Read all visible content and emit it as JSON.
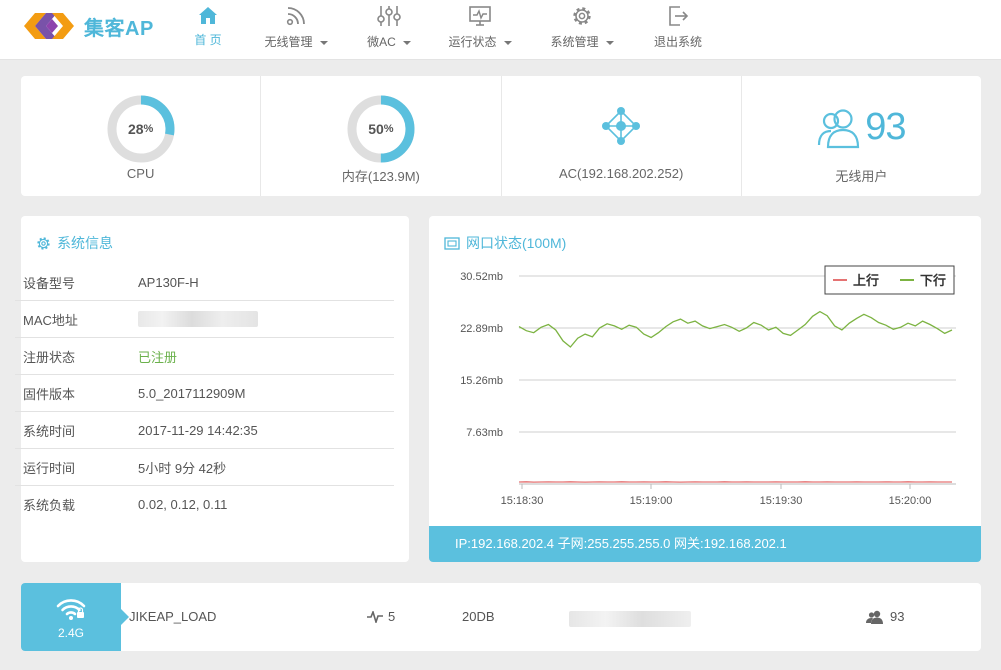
{
  "brand": {
    "name": "集客AP"
  },
  "nav": [
    {
      "label": "首 页",
      "icon": "home-icon",
      "active": true,
      "dropdown": false
    },
    {
      "label": "无线管理",
      "icon": "rss-icon",
      "active": false,
      "dropdown": true
    },
    {
      "label": "微AC",
      "icon": "sliders-icon",
      "active": false,
      "dropdown": true
    },
    {
      "label": "运行状态",
      "icon": "monitor-icon",
      "active": false,
      "dropdown": true
    },
    {
      "label": "系统管理",
      "icon": "gear-icon",
      "active": false,
      "dropdown": true
    },
    {
      "label": "退出系统",
      "icon": "logout-icon",
      "active": false,
      "dropdown": false
    }
  ],
  "stats": {
    "cpu": {
      "value": "28",
      "unit": "%",
      "label": "CPU",
      "percent": 28
    },
    "memory": {
      "value": "50",
      "unit": "%",
      "label": "内存(123.9M)",
      "percent": 50
    },
    "ac": {
      "label": "AC(192.168.202.252)"
    },
    "users": {
      "count": "93",
      "label": "无线用户"
    }
  },
  "sysinfo": {
    "title": "系统信息",
    "rows": [
      {
        "key": "设备型号",
        "value": "AP130F-H"
      },
      {
        "key": "MAC地址",
        "value": ""
      },
      {
        "key": "注册状态",
        "value": "已注册"
      },
      {
        "key": "固件版本",
        "value": "5.0_2017112909M"
      },
      {
        "key": "系统时间",
        "value": "2017-11-29 14:42:35"
      },
      {
        "key": "运行时间",
        "value": "5小时 9分 42秒"
      },
      {
        "key": "系统负载",
        "value": "0.02, 0.12, 0.11"
      }
    ]
  },
  "network": {
    "title": "网口状态(100M)",
    "footer": "IP:192.168.202.4  子网:255.255.255.0  网关:192.168.202.1"
  },
  "chart_data": {
    "type": "line",
    "title": "",
    "y_ticks": [
      "30.52mb",
      "22.89mb",
      "15.26mb",
      "7.63mb"
    ],
    "x_ticks": [
      "15:18:30",
      "15:19:00",
      "15:19:30",
      "15:20:00"
    ],
    "ylim": [
      0,
      30.52
    ],
    "legend": "top-right",
    "grid": true,
    "series": [
      {
        "name": "上行",
        "color": "#e57373",
        "values": [
          0.3,
          0.32,
          0.28,
          0.3,
          0.31,
          0.29,
          0.3,
          0.33,
          0.3,
          0.28,
          0.3,
          0.31,
          0.3,
          0.29,
          0.32,
          0.3,
          0.3,
          0.31,
          0.29,
          0.3,
          0.32,
          0.3,
          0.28,
          0.3,
          0.31,
          0.3,
          0.29,
          0.3,
          0.32,
          0.3,
          0.3,
          0.31,
          0.29,
          0.3,
          0.3,
          0.31,
          0.3,
          0.29,
          0.3,
          0.32,
          0.3,
          0.3,
          0.31,
          0.3,
          0.29,
          0.3,
          0.31,
          0.3,
          0.3,
          0.3,
          0.31,
          0.29,
          0.3,
          0.32,
          0.3,
          0.3,
          0.31,
          0.3,
          0.29,
          0.3
        ]
      },
      {
        "name": "下行",
        "color": "#7cb342",
        "values": [
          23.1,
          22.5,
          22.2,
          23.0,
          23.4,
          22.6,
          21.0,
          20.1,
          21.4,
          22.0,
          21.6,
          22.9,
          23.5,
          23.2,
          22.7,
          23.3,
          23.0,
          22.0,
          21.5,
          22.2,
          23.1,
          23.8,
          24.2,
          23.6,
          23.9,
          23.2,
          22.8,
          23.1,
          23.4,
          23.0,
          22.4,
          22.9,
          23.7,
          23.3,
          22.6,
          23.0,
          22.1,
          21.8,
          22.6,
          23.4,
          24.6,
          25.3,
          24.7,
          23.2,
          22.6,
          23.6,
          24.3,
          24.9,
          24.4,
          23.7,
          23.3,
          22.7,
          23.0,
          23.6,
          23.2,
          23.9,
          23.4,
          22.8,
          22.1,
          22.6
        ]
      }
    ]
  },
  "wifi": {
    "band": "2.4G",
    "ssid": "JIKEAP_LOAD",
    "clients": "5",
    "power": "20DB",
    "users": "93"
  }
}
